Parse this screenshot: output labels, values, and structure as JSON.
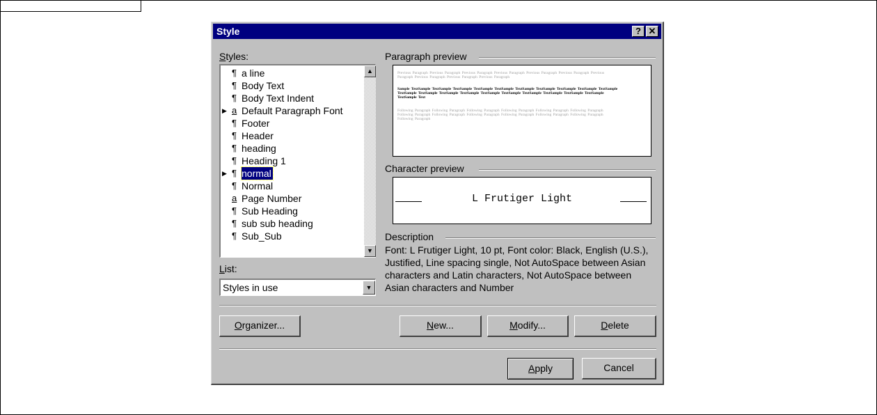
{
  "dialog": {
    "title": "Style",
    "help_label": "?",
    "close_label": "✕"
  },
  "styles_label": {
    "u": "S",
    "rest": "tyles:"
  },
  "styles": [
    {
      "glyph": "¶",
      "label": "a line",
      "arrow": "",
      "selected": false
    },
    {
      "glyph": "¶",
      "label": "Body Text",
      "arrow": "",
      "selected": false
    },
    {
      "glyph": "¶",
      "label": "Body Text Indent",
      "arrow": "",
      "selected": false
    },
    {
      "glyph": "a",
      "label": "Default Paragraph Font",
      "arrow": "▶",
      "selected": false
    },
    {
      "glyph": "¶",
      "label": "Footer",
      "arrow": "",
      "selected": false
    },
    {
      "glyph": "¶",
      "label": "Header",
      "arrow": "",
      "selected": false
    },
    {
      "glyph": "¶",
      "label": "heading",
      "arrow": "",
      "selected": false
    },
    {
      "glyph": "¶",
      "label": "Heading 1",
      "arrow": "",
      "selected": false
    },
    {
      "glyph": "¶",
      "label": "normal",
      "arrow": "▶",
      "selected": true
    },
    {
      "glyph": "¶",
      "label": "Normal",
      "arrow": "",
      "selected": false
    },
    {
      "glyph": "a",
      "label": "Page Number",
      "arrow": "",
      "selected": false
    },
    {
      "glyph": "¶",
      "label": "Sub Heading",
      "arrow": "",
      "selected": false
    },
    {
      "glyph": "¶",
      "label": "sub sub heading",
      "arrow": "",
      "selected": false
    },
    {
      "glyph": "¶",
      "label": "Sub_Sub",
      "arrow": "",
      "selected": false
    }
  ],
  "scroll": {
    "up": "▲",
    "down": "▼"
  },
  "list_label": {
    "u": "L",
    "rest": "ist:"
  },
  "list_value": "Styles in use",
  "combo_arrow": "▼",
  "paragraph_preview": {
    "label": "Paragraph preview",
    "previous_text": "Previous Paragraph Previous Paragraph Previous Paragraph Previous Paragraph Previous Paragraph Previous Paragraph Previous Paragraph Previous Paragraph Previous Paragraph Previous Paragraph",
    "sample_text": "Sample TextSample TextSample TextSample TextSample TextSample TextSample TextSample TextSample TextSample TextSample TextSample TextSample TextSample TextSample TextSample TextSample TextSample TextSample TextSample TextSample TextSample Text",
    "following_text": "Following Paragraph Following Paragraph Following Paragraph Following Paragraph Following Paragraph Following Paragraph Following Paragraph Following Paragraph Following Paragraph Following Paragraph Following Paragraph Following Paragraph Following Paragraph"
  },
  "character_preview": {
    "label": "Character preview",
    "sample": "L Frutiger Light"
  },
  "description": {
    "label": "Description",
    "text": "Font: L Frutiger Light, 10 pt, Font color: Black, English (U.S.), Justified, Line spacing single, Not AutoSpace between Asian characters and Latin characters, Not AutoSpace between Asian characters and Number"
  },
  "buttons": {
    "organizer": {
      "u": "O",
      "rest": "rganizer..."
    },
    "new": {
      "u": "N",
      "rest": "ew..."
    },
    "modify": {
      "u": "M",
      "rest": "odify..."
    },
    "delete": {
      "u": "D",
      "rest": "elete"
    },
    "apply": {
      "u": "A",
      "rest": "pply"
    },
    "cancel": "Cancel"
  }
}
